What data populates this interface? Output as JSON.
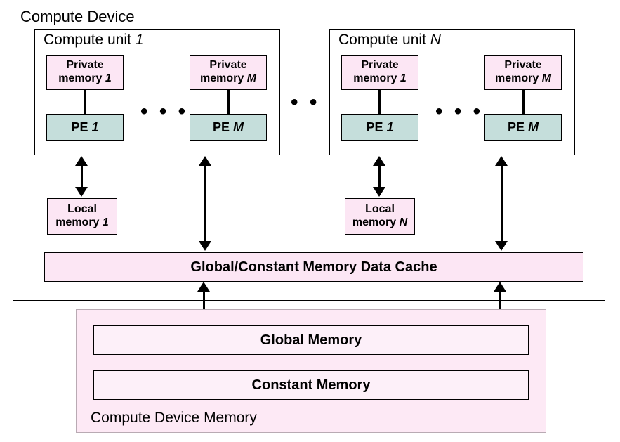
{
  "device": {
    "label": "Compute Device"
  },
  "cu1": {
    "label_plain": "Compute unit ",
    "label_ital": "1",
    "pm1": {
      "line1": "Private",
      "line2_plain": "memory ",
      "line2_ital": "1"
    },
    "pmM": {
      "line1": "Private",
      "line2_plain": "memory ",
      "line2_ital": "M"
    },
    "pe1": {
      "plain": "PE ",
      "ital": "1"
    },
    "peM": {
      "plain": "PE ",
      "ital": "M"
    },
    "dots": "• • •"
  },
  "cuN": {
    "label_plain": "Compute unit ",
    "label_ital": "N",
    "pm1": {
      "line1": "Private",
      "line2_plain": "memory ",
      "line2_ital": "1"
    },
    "pmM": {
      "line1": "Private",
      "line2_plain": "memory ",
      "line2_ital": "M"
    },
    "pe1": {
      "plain": "PE ",
      "ital": "1"
    },
    "peM": {
      "plain": "PE ",
      "ital": "M"
    },
    "dots": "• • •"
  },
  "between_dots": "• • •",
  "lm1": {
    "line1": "Local",
    "line2_plain": "memory ",
    "line2_ital": "1"
  },
  "lmN": {
    "line1": "Local",
    "line2_plain": "memory ",
    "line2_ital": "N"
  },
  "gcache": "Global/Constant Memory Data Cache",
  "device_memory": {
    "label": "Compute Device Memory",
    "global": "Global Memory",
    "constant": "Constant Memory"
  }
}
